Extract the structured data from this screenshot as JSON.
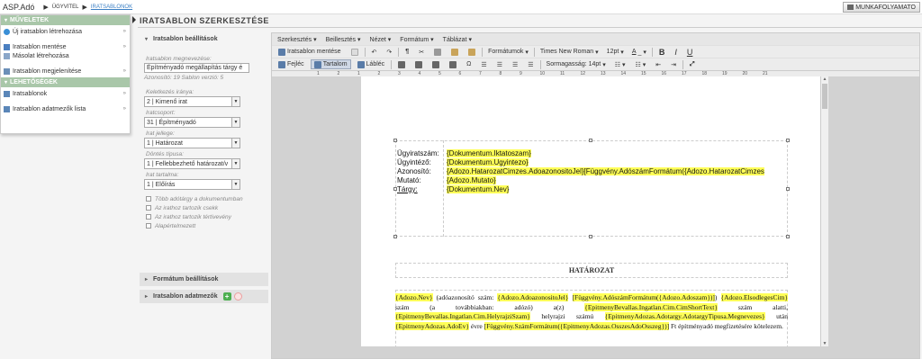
{
  "app": {
    "name": "ASP.Adó"
  },
  "breadcrumb": {
    "item1": "ÜGYVITEL",
    "item2": "IRATSABLONOK"
  },
  "workflow_button": {
    "label": "MUNKAFOLYAMATO"
  },
  "left_menu": {
    "section1": "MŰVELETEK",
    "items1": [
      "Új iratsablon létrehozása",
      "Iratsablon mentése",
      "Másolat létrehozása",
      "Iratsablon megjelenítése"
    ],
    "section2": "LEHETŐSÉGEK",
    "items2": [
      "Iratsablonok",
      "Iratsablon adatmezők lista"
    ]
  },
  "page_title": "IRATSABLON SZERKESZTÉSE",
  "settings": {
    "header": "Iratsablon beállítások",
    "name_label": "Iratsablon megnevezése:",
    "name_value": "Építményadó megállapítás tárgy é",
    "info": "Azonosító: 19  Sablon verzió: 5",
    "direction_label": "Keletkezés iránya:",
    "direction_value": "2 | Kimenő irat",
    "group_label": "Iratcsoport:",
    "group_value": "31 | Építményadó",
    "nature_label": "Irat jellege:",
    "nature_value": "1 | Határozat",
    "decision_label": "Döntés típusa:",
    "decision_value": "1 | Fellebbezhető határozat/v",
    "content_label": "Irat tartalma:",
    "content_value": "1 | Előírás",
    "checkboxes": [
      "Több adótárgy a dokumentumban",
      "Az irathoz tartozik csekk",
      "Az irathoz tartozik tértivevény",
      "Alapértelmezett"
    ],
    "format_header": "Formátum beállítások",
    "fields_header": "Iratsablon adatmezők"
  },
  "editor": {
    "menus": [
      "Szerkesztés",
      "Beillesztés",
      "Nézet",
      "Formátum",
      "Táblázat"
    ],
    "save_label": "Iratsablon mentése",
    "formats_label": "Formátumok",
    "font_label": "Times New Roman",
    "size_label": "12pt",
    "bold_label": "B",
    "italic_label": "I",
    "underline_label": "U",
    "header_label": "Fejléc",
    "content_label": "Tartalom",
    "footer_label": "Lábléc",
    "linespacing_label": "Sormagasság: 14pt",
    "ruler_numbers": [
      "1",
      "2",
      "1",
      "2",
      "3",
      "4",
      "5",
      "6",
      "7",
      "8",
      "9",
      "10",
      "11",
      "12",
      "13",
      "14",
      "15",
      "16",
      "17",
      "18",
      "19",
      "20",
      "21"
    ]
  },
  "doc": {
    "rows": [
      {
        "label": "Ügyiratszám:",
        "value": "{Dokumentum.Iktatoszam}"
      },
      {
        "label": "Ügyintéző:",
        "value": "{Dokumentum.Ugyintezo}"
      },
      {
        "label": "Azonosító:",
        "value": "{Adozo.HatarozatCimzes.AdoazonositoJel}[Függvény.AdószámFormátum({Adozo.HatarozatCimzes"
      },
      {
        "label": "Mutató:",
        "value": "{Adozo.Mutato}"
      },
      {
        "label": "Tárgy:",
        "value": "{Dokumentum.Nev}"
      }
    ],
    "heading": "HATÁROZAT",
    "p1": "{Adozo.Nev}",
    "p2": " (adóazonosító szám: ",
    "p3": "{Adozo.AdoazonositoJel}",
    "p4": " ",
    "p5": "[Függvény.AdószámFormátum({Adozo.Adoszam})]",
    "p6": ") ",
    "p7": "{Adozo.ElsodlegesCim}",
    "p8": " szám (a továbbiakban: adózó) a(z) ",
    "p9": "{EpitmenyBevallas.Ingatlan.Cim.CimShortText}",
    "p10": " szám alatti, ",
    "p11": "{EpitmenyBevallas.Ingatlan.Cim.HelyrajziSzam}",
    "p12": " helyrajzi számú ",
    "p13": "{EpitmenyAdozas.Adotargy.AdotargyTipusa.Megnevezes}",
    "p14": " után ",
    "p15": "{EpitmenyAdozas.AdoEv}",
    "p16": " évre ",
    "p17": "[Függvény.SzámFormátum({EpitmenyAdozas.OsszesAdoOsszeg})]",
    "p18": " Ft építményadó megfizetésére kötelezem."
  }
}
